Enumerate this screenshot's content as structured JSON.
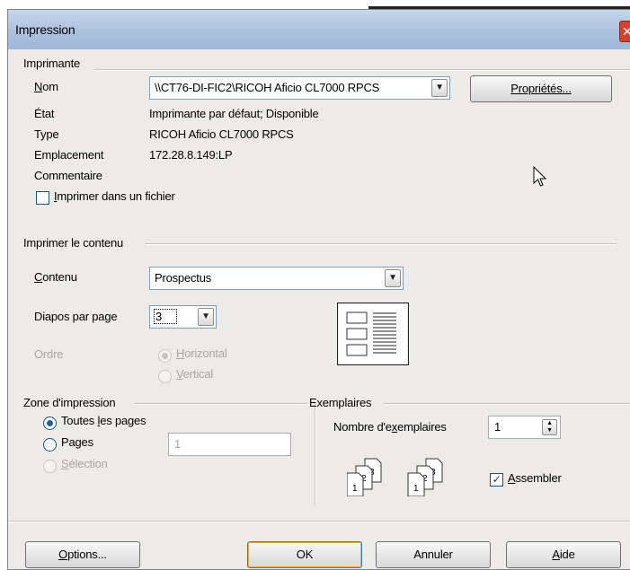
{
  "window": {
    "title": "Impression",
    "close_glyph": "✕"
  },
  "printer": {
    "group_label": "Imprimante",
    "name_label": "Nom",
    "name_value": "\\\\CT76-DI-FIC2\\RICOH Aficio CL7000 RPCS",
    "properties_button": "Propriétés...",
    "state_label": "État",
    "state_value": "Imprimante par défaut; Disponible",
    "type_label": "Type",
    "type_value": "RICOH Aficio CL7000 RPCS",
    "location_label": "Emplacement",
    "location_value": "172.28.8.149:LP",
    "comment_label": "Commentaire",
    "print_to_file_label": "Imprimer dans un fichier",
    "print_to_file_checked": false
  },
  "content": {
    "group_label": "Imprimer le contenu",
    "content_label": "Contenu",
    "content_value": "Prospectus",
    "slides_per_page_label": "Diapos par page",
    "slides_per_page_value": "3",
    "order_label": "Ordre",
    "order_options": [
      "Horizontal",
      "Vertical"
    ],
    "order_selected": "Horizontal"
  },
  "print_range": {
    "group_label": "Zone d'impression",
    "all_pages_label": "Toutes les pages",
    "pages_label": "Pages",
    "pages_value": "1",
    "selection_label": "Sélection",
    "selected": "all"
  },
  "copies": {
    "group_label": "Exemplaires",
    "count_label": "Nombre d'exemplaires",
    "count_value": "1",
    "collate_label": "Assembler",
    "collate_checked": true
  },
  "buttons": {
    "options": "Options...",
    "ok": "OK",
    "cancel": "Annuler",
    "help": "Aide"
  },
  "icons": {
    "close": "close-icon",
    "dropdown": "chevron-down-icon",
    "spinner": "spinner-arrows-icon",
    "layout_preview": "handout-layout-preview-icon",
    "collate_pages": "collated-pages-icon",
    "cursor": "mouse-pointer-icon"
  }
}
